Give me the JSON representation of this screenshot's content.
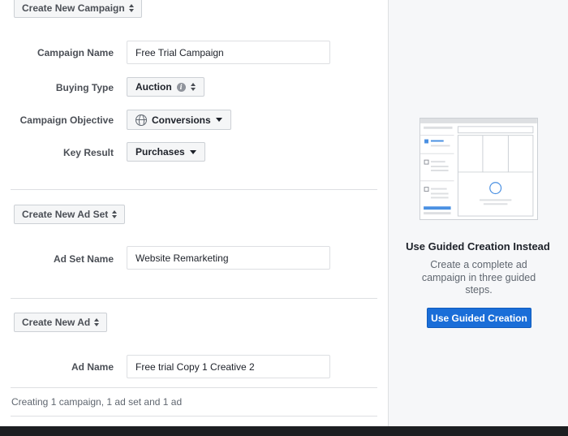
{
  "campaign": {
    "header_button": "Create New Campaign",
    "name_label": "Campaign Name",
    "name_value": "Free Trial Campaign",
    "buying_type_label": "Buying Type",
    "buying_type_value": "Auction",
    "objective_label": "Campaign Objective",
    "objective_value": "Conversions",
    "key_result_label": "Key Result",
    "key_result_value": "Purchases"
  },
  "ad_set": {
    "header_button": "Create New Ad Set",
    "name_label": "Ad Set Name",
    "name_value": "Website Remarketing"
  },
  "ad": {
    "header_button": "Create New Ad",
    "name_label": "Ad Name",
    "name_value": "Free trial Copy 1 Creative 2"
  },
  "summary": "Creating 1 campaign, 1 ad set and 1 ad",
  "guided": {
    "title": "Use Guided Creation Instead",
    "description": "Create a complete ad campaign in three guided steps.",
    "button": "Use Guided Creation"
  },
  "colors": {
    "primary_button": "#1a6ed8",
    "panel_bg": "#f6f7f9",
    "bottom_bar": "#1c1e21"
  },
  "icons": {
    "info": "info-icon",
    "objective": "globe-icon",
    "sort": "updown-arrows-icon",
    "dropdown": "caret-down-icon"
  }
}
